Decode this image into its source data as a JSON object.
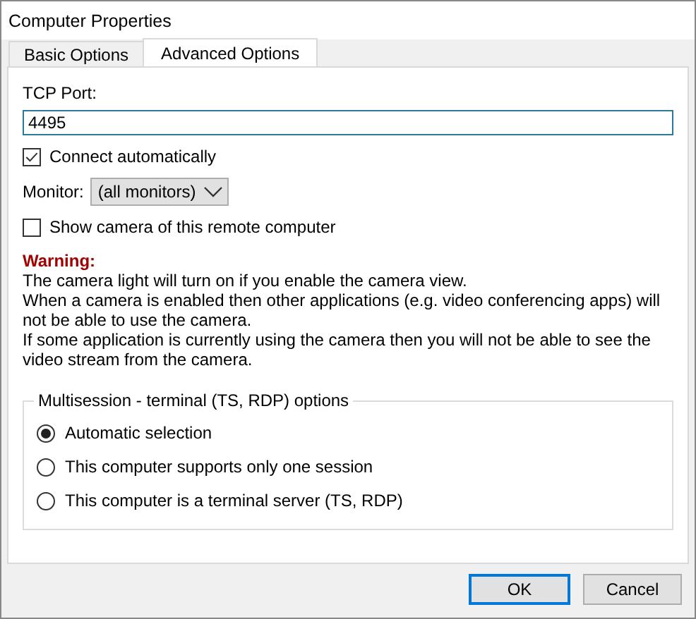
{
  "window": {
    "title": "Computer Properties"
  },
  "tabs": [
    {
      "label": "Basic Options",
      "selected": false
    },
    {
      "label": "Advanced Options",
      "selected": true
    }
  ],
  "tcp_port": {
    "label": "TCP Port:",
    "value": "4495"
  },
  "connect_automatically": {
    "label": "Connect automatically",
    "checked": true
  },
  "monitor": {
    "label": "Monitor:",
    "value": "(all monitors)"
  },
  "show_camera": {
    "label": "Show camera of this remote computer",
    "checked": false
  },
  "warning": {
    "title": "Warning:",
    "paragraphs": [
      "The camera light will turn on if you enable the camera view.",
      "When a camera is enabled then other applications (e.g. video conferencing apps) will not be able to use the camera.",
      "If some application is currently using the camera then you will not be able to see the video stream from the camera."
    ]
  },
  "multisession": {
    "title": "Multisession - terminal (TS, RDP) options",
    "options": [
      {
        "label": "Automatic selection",
        "selected": true
      },
      {
        "label": "This computer supports only one session",
        "selected": false
      },
      {
        "label": "This computer is a terminal server (TS, RDP)",
        "selected": false
      }
    ]
  },
  "buttons": [
    {
      "label": "OK",
      "kind": "default"
    },
    {
      "label": "Cancel",
      "kind": "normal"
    }
  ]
}
